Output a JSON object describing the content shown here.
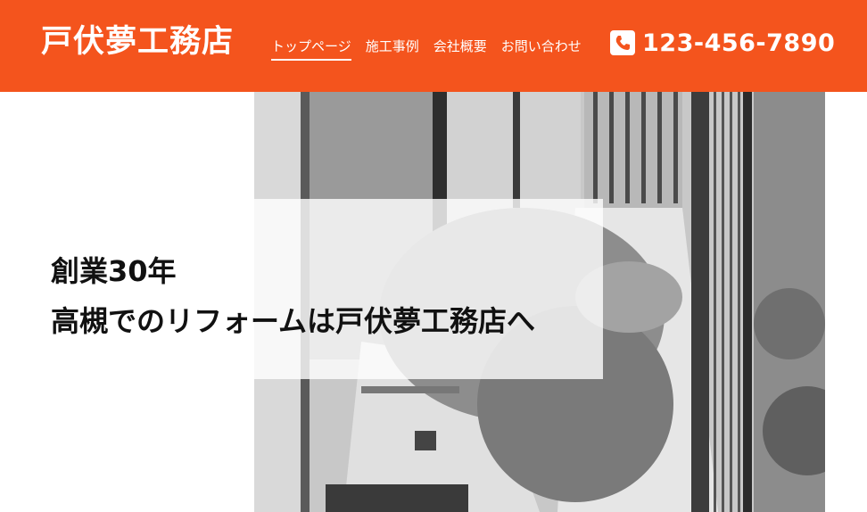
{
  "header": {
    "logo": "戸伏夢工務店",
    "nav": [
      {
        "label": "トップページ",
        "active": true
      },
      {
        "label": "施工事例",
        "active": false
      },
      {
        "label": "会社概要",
        "active": false
      },
      {
        "label": "お問い合わせ",
        "active": false
      }
    ],
    "phone": {
      "icon": "phone-icon",
      "number": "123-456-7890"
    },
    "color": "#f4541d"
  },
  "hero": {
    "line1": "創業30年",
    "line2": "高槻でのリフォームは戸伏夢工務店へ"
  }
}
